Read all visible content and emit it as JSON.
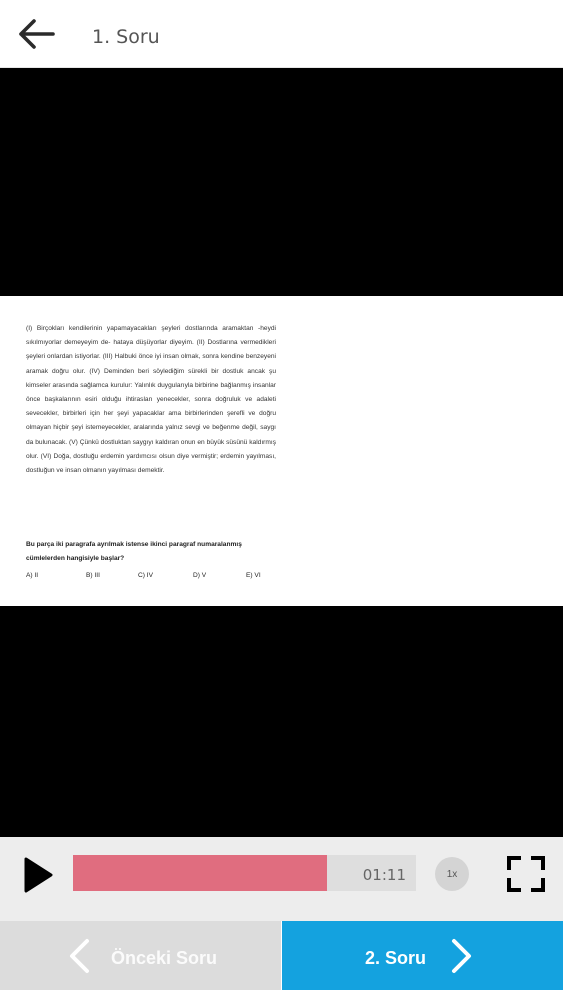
{
  "header": {
    "title": "1. Soru",
    "back_icon": "arrow-left-icon"
  },
  "question_image": {
    "passage": "(I) Birçokları kendilerinin yapamayacakları şeyleri dostlarında aramaktan -heydi sıkılmıyorlar demeyeyim de- hatayа düşüyorlar diyeyim. (II) Dostlarına vermedikleri şeyleri onlardan istiyorlar. (III) Halbuki önce iyi insan olmak, sonra kendine benzeyeni aramak doğru olur. (IV) Deminden beri söylediğim sürekli bir dostluk ancak şu kimseler arasında sağlamca kurulur: Yalınlık duygularıyla birbirine bağlanmış insanlar önce başkalarının esiri olduğu ihtiraslan yenecekler, sonra doğruluk ve adaleti sevecekler, birbirleri için her şeyi yapacaklar ama birbirlerinden şerefli ve doğru olmayan hiçbir şeyi istemeyecekler, aralarında yalnız sevgi ve beğenme değil, saygı da bulunacak. (V) Çünkü dostluktan saygıyı kaldıran onun en büyük süsünü kaldırmış olur. (VI) Doğa, dostluğu erdemin yardımcısı olsun diye vermiştir; erdemin yayılması, dostluğun ve insan olmanın yayılması demektir.",
    "question": "Bu parça iki paragrafa ayrılmak istense ikinci paragraf numaralanmış cümlelerden hangisiyle başlar?",
    "options": [
      "A) II",
      "B) III",
      "C) IV",
      "D) V",
      "E) VI"
    ]
  },
  "player": {
    "play_icon": "play-icon",
    "progress": 0.74,
    "time": "01:11",
    "speed": "1x",
    "fullscreen_icon": "fullscreen-icon",
    "progress_color": "#e06d7f"
  },
  "nav": {
    "prev_label": "Önceki Soru",
    "next_label": "2. Soru",
    "prev_icon": "chevron-left-icon",
    "next_icon": "chevron-right-icon",
    "accent_color": "#14a2df"
  }
}
